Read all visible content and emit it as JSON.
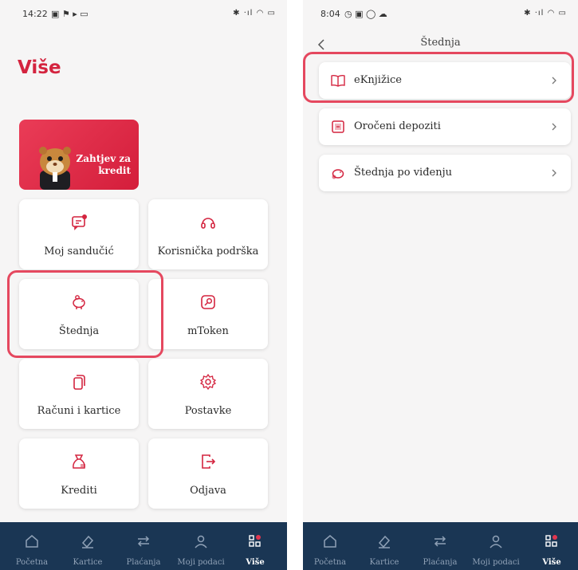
{
  "left": {
    "status": {
      "time": "14:22",
      "icons": "▣ ⚑ ▸ ▭",
      "system": "✱ ‧ıl ◠ ▭"
    },
    "title": "Više",
    "promo": {
      "line1": "Zahtjev za",
      "line2": "kredit"
    },
    "tiles": [
      {
        "label": "Moj sandučić",
        "icon": "mailbox-icon"
      },
      {
        "label": "Korisnička podrška",
        "icon": "headset-icon"
      },
      {
        "label": "Štednja",
        "icon": "piggy-bank-icon"
      },
      {
        "label": "mToken",
        "icon": "key-icon"
      },
      {
        "label": "Računi i kartice",
        "icon": "cards-icon"
      },
      {
        "label": "Postavke",
        "icon": "gear-icon"
      },
      {
        "label": "Krediti",
        "icon": "money-bag-icon"
      },
      {
        "label": "Odjava",
        "icon": "logout-icon"
      }
    ]
  },
  "right": {
    "status": {
      "time": "8:04",
      "icons": "◷ ▣ ◯ ☁",
      "system": "✱ ‧ıl ◠ ▭"
    },
    "title": "Štednja",
    "rows": [
      {
        "label": "eKnjižice",
        "icon": "book-icon"
      },
      {
        "label": "Oročeni depoziti",
        "icon": "deposit-icon"
      },
      {
        "label": "Štednja po viđenju",
        "icon": "piggy-bank-icon"
      }
    ]
  },
  "nav": {
    "items": [
      "Početna",
      "Kartice",
      "Plaćanja",
      "Moji podaci",
      "Više"
    ],
    "active": "Više"
  },
  "colors": {
    "accent": "#d4243f",
    "nav_bg": "#1a3654",
    "highlight": "#e5485f"
  }
}
